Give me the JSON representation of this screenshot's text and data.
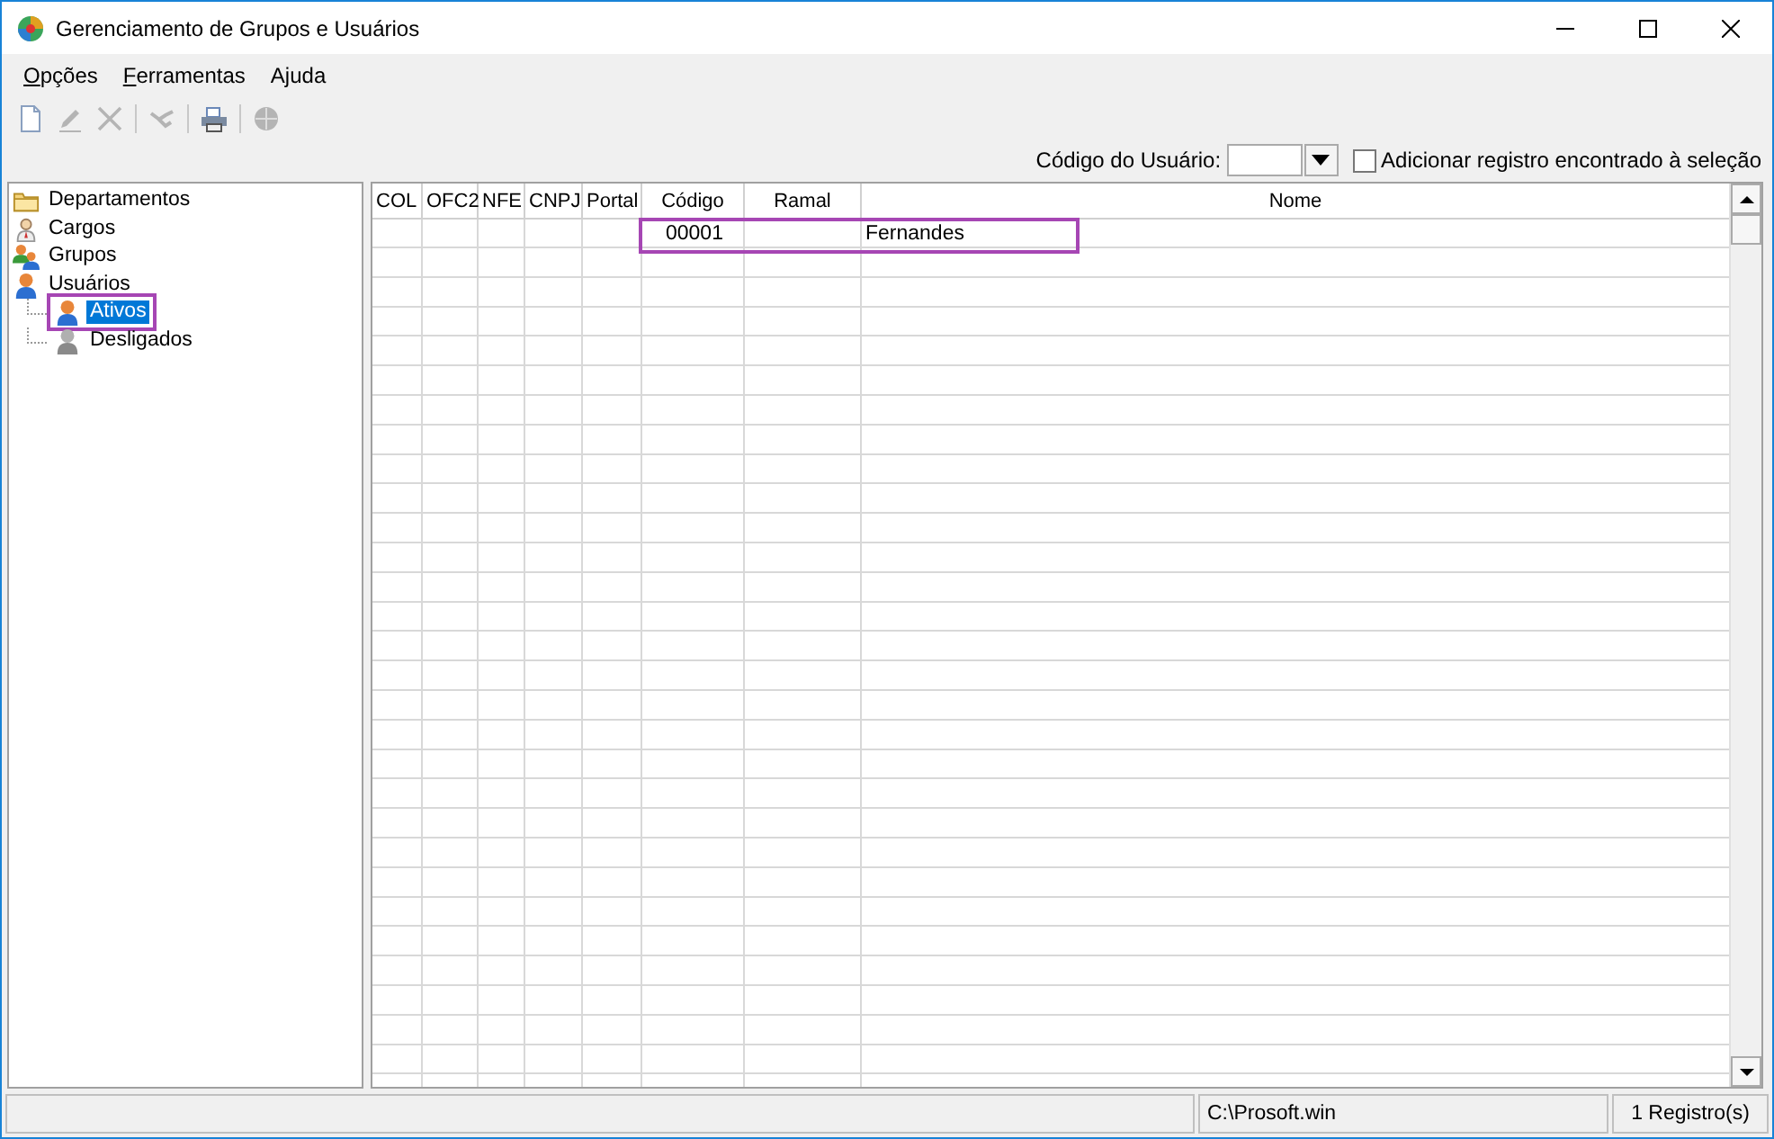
{
  "window": {
    "title": "Gerenciamento de Grupos e Usuários"
  },
  "menu": [
    {
      "label": "Opções",
      "mnemonic": true
    },
    {
      "label": "Ferramentas",
      "mnemonic": true
    },
    {
      "label": "Ajuda",
      "mnemonic": false
    }
  ],
  "toolbar": [
    {
      "kind": "new",
      "disabled": false
    },
    {
      "kind": "edit",
      "disabled": true
    },
    {
      "kind": "delete",
      "disabled": true
    },
    {
      "kind": "separator"
    },
    {
      "kind": "handshake",
      "disabled": true
    },
    {
      "kind": "separator"
    },
    {
      "kind": "print",
      "disabled": false
    },
    {
      "kind": "separator"
    },
    {
      "kind": "globe",
      "disabled": true
    }
  ],
  "filter": {
    "label": "Código do Usuário:",
    "checkbox": {
      "label": "Adicionar registro encontrado à seleção",
      "checked": false
    }
  },
  "tree": [
    {
      "label": "Departamentos",
      "kind": "folder",
      "selected": false
    },
    {
      "label": "Cargos",
      "kind": "role",
      "selected": false
    },
    {
      "label": "Grupos",
      "kind": "group",
      "selected": false
    },
    {
      "label": "Usuários",
      "kind": "user",
      "selected": false,
      "children": [
        {
          "label": "Ativos",
          "kind": "user",
          "selected": true,
          "highlighted": true
        },
        {
          "label": "Desligados",
          "kind": "user-inactive",
          "selected": false,
          "highlighted": false
        }
      ]
    }
  ],
  "table": {
    "columns": [
      "COL",
      "OFC2",
      "NFE",
      "CNPJ",
      "Portal",
      "Código",
      "Ramal",
      "Nome"
    ],
    "rows": [
      {
        "cells": [
          "",
          "",
          "",
          "",
          "",
          "00001",
          "",
          "Fernandes"
        ],
        "highlighted": true
      }
    ]
  },
  "status_bar": [
    "C:\\Prosoft.win",
    "1 Registro(s)"
  ]
}
